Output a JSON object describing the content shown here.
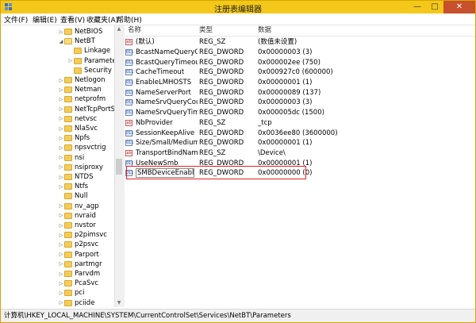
{
  "titlebar": {
    "title": "注册表编辑器",
    "minimize": "—",
    "maximize": "□",
    "close": "✕"
  },
  "menu": [
    "文件(F)",
    "编辑(E)",
    "查看(V)",
    "收藏夹(A)",
    "帮助(H)"
  ],
  "tree": [
    {
      "label": "NetBIOS",
      "arrow": "▷",
      "open": false
    },
    {
      "label": "NetBT",
      "arrow": "◢",
      "open": true
    },
    {
      "label": "Linkage",
      "arrow": "",
      "open": false
    },
    {
      "label": "Parameters",
      "arrow": "▷",
      "open": false
    },
    {
      "label": "Security",
      "arrow": "",
      "open": false
    },
    {
      "label": "Netlogon",
      "arrow": "▷",
      "open": false
    },
    {
      "label": "Netman",
      "arrow": "▷",
      "open": false
    },
    {
      "label": "netprofm",
      "arrow": "▷",
      "open": false
    },
    {
      "label": "NetTcpPortSha",
      "arrow": "▷",
      "open": false
    },
    {
      "label": "netvsc",
      "arrow": "▷",
      "open": false
    },
    {
      "label": "NlaSvc",
      "arrow": "▷",
      "open": false
    },
    {
      "label": "Npfs",
      "arrow": "▷",
      "open": false
    },
    {
      "label": "npsvctrig",
      "arrow": "▷",
      "open": false
    },
    {
      "label": "nsi",
      "arrow": "▷",
      "open": false
    },
    {
      "label": "nsiproxy",
      "arrow": "▷",
      "open": false
    },
    {
      "label": "NTDS",
      "arrow": "▷",
      "open": false
    },
    {
      "label": "Ntfs",
      "arrow": "▷",
      "open": false
    },
    {
      "label": "Null",
      "arrow": "",
      "open": false
    },
    {
      "label": "nv_agp",
      "arrow": "▷",
      "open": false
    },
    {
      "label": "nvraid",
      "arrow": "▷",
      "open": false
    },
    {
      "label": "nvstor",
      "arrow": "▷",
      "open": false
    },
    {
      "label": "p2pimsvc",
      "arrow": "▷",
      "open": false
    },
    {
      "label": "p2psvc",
      "arrow": "▷",
      "open": false
    },
    {
      "label": "Parport",
      "arrow": "▷",
      "open": false
    },
    {
      "label": "partmgr",
      "arrow": "▷",
      "open": false
    },
    {
      "label": "Parvdm",
      "arrow": "▷",
      "open": false
    },
    {
      "label": "PcaSvc",
      "arrow": "▷",
      "open": false
    },
    {
      "label": "pci",
      "arrow": "▷",
      "open": false
    },
    {
      "label": "pciide",
      "arrow": "▷",
      "open": false
    }
  ],
  "columns": {
    "name": "名称",
    "type": "类型",
    "data": "数据"
  },
  "values": [
    {
      "name": "(默认)",
      "type": "REG_SZ",
      "data": "(数值未设置)",
      "kind": "sz"
    },
    {
      "name": "BcastNameQueryC...",
      "type": "REG_DWORD",
      "data": "0x00000003 (3)",
      "kind": "dw"
    },
    {
      "name": "BcastQueryTimeout",
      "type": "REG_DWORD",
      "data": "0x000002ee (750)",
      "kind": "dw"
    },
    {
      "name": "CacheTimeout",
      "type": "REG_DWORD",
      "data": "0x000927c0 (600000)",
      "kind": "dw"
    },
    {
      "name": "EnableLMHOSTS",
      "type": "REG_DWORD",
      "data": "0x00000001 (1)",
      "kind": "dw"
    },
    {
      "name": "NameServerPort",
      "type": "REG_DWORD",
      "data": "0x00000089 (137)",
      "kind": "dw"
    },
    {
      "name": "NameSrvQueryCount",
      "type": "REG_DWORD",
      "data": "0x00000003 (3)",
      "kind": "dw"
    },
    {
      "name": "NameSrvQueryTim...",
      "type": "REG_DWORD",
      "data": "0x000005dc (1500)",
      "kind": "dw"
    },
    {
      "name": "NbProvider",
      "type": "REG_SZ",
      "data": "_tcp",
      "kind": "sz"
    },
    {
      "name": "SessionKeepAlive",
      "type": "REG_DWORD",
      "data": "0x0036ee80 (3600000)",
      "kind": "dw"
    },
    {
      "name": "Size/Small/Medium...",
      "type": "REG_DWORD",
      "data": "0x00000001 (1)",
      "kind": "dw"
    },
    {
      "name": "TransportBindName",
      "type": "REG_SZ",
      "data": "\\Device\\",
      "kind": "sz"
    },
    {
      "name": "UseNewSmb",
      "type": "REG_DWORD",
      "data": "0x00000001 (1)",
      "kind": "dw"
    },
    {
      "name": "SMBDeviceEnabled",
      "type": "REG_DWORD",
      "data": "0x00000000 (0)",
      "kind": "dw"
    }
  ],
  "icons": {
    "sz": "ab",
    "dw": "011"
  },
  "status": "计算机\\HKEY_LOCAL_MACHINE\\SYSTEM\\CurrentControlSet\\Services\\NetBT\\Parameters",
  "colors": {
    "titlebar": "#f4c81a",
    "highlight": "#e32222"
  }
}
